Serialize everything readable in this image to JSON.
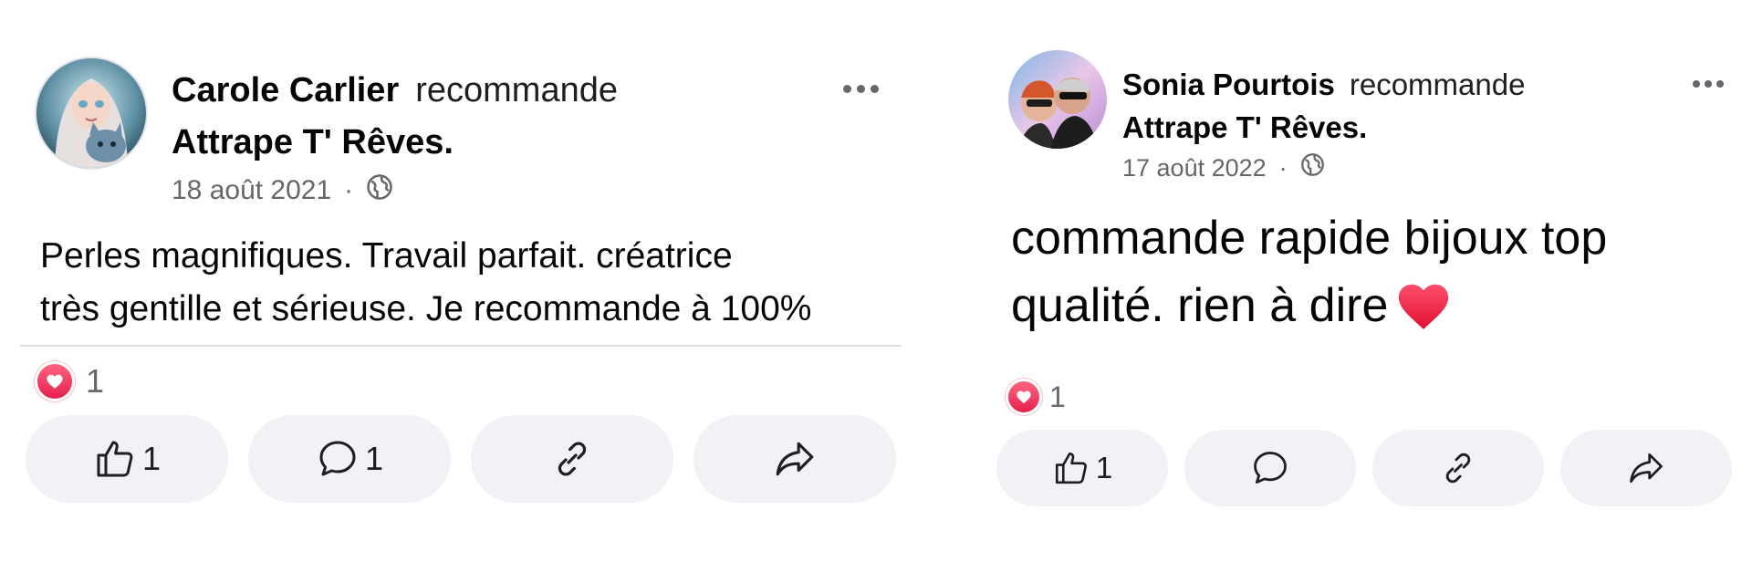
{
  "posts": [
    {
      "author": "Carole Carlier",
      "verb": "recommande",
      "page": "Attrape T' Rêves.",
      "date": "18 août 2021",
      "separator": "·",
      "audience_icon": "globe-icon",
      "text_line_1": "Perles magnifiques. Travail parfait. créatrice",
      "text_line_2": "très gentille et sérieuse. Je recommande à 100%",
      "reaction_count": "1",
      "like_count": "1",
      "comment_count": "1"
    },
    {
      "author": "Sonia Pourtois",
      "verb": "recommande",
      "page": "Attrape T' Rêves.",
      "date": "17 août 2022",
      "separator": "·",
      "audience_icon": "globe-icon",
      "text_line_1": "commande rapide bijoux top",
      "text_line_2": "qualité.  rien à dire",
      "reaction_count": "1",
      "like_count": "1"
    }
  ],
  "colors": {
    "meta_text": "#65676b",
    "button_bg": "#f0f2f5",
    "love_red": "#e61e4d"
  }
}
